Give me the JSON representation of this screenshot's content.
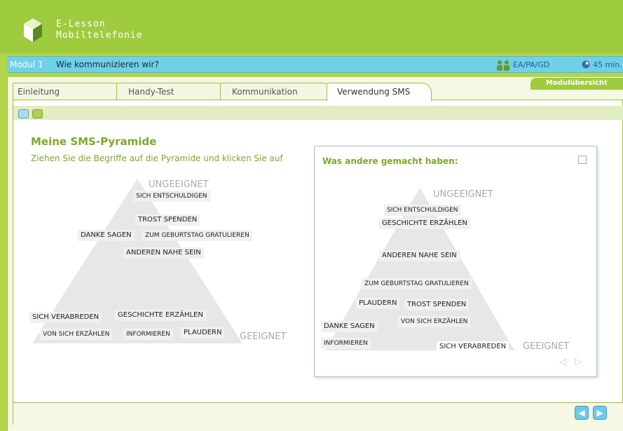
{
  "header": {
    "line1": "E-Lesson",
    "line2": "Mobiltelefonie"
  },
  "module": {
    "number": "Modul 1",
    "title": "Wie kommunizieren wir?",
    "method": "EA/PA/GD",
    "time": "45 min."
  },
  "tabs": [
    {
      "label": "Einleitung"
    },
    {
      "label": "Handy-Test"
    },
    {
      "label": "Kommunikation"
    },
    {
      "label": "Verwendung SMS"
    }
  ],
  "overview_label": "Modulübersicht",
  "main": {
    "heading": "Meine SMS-Pyramide",
    "instruction": "Ziehen Sie die Begriffe auf die Pyramide und klicken Sie auf",
    "top_label": "UNGEEIGNET",
    "bottom_label": "GEEIGNET",
    "chips": [
      "SICH ENTSCHULDIGEN",
      "TROST SPENDEN",
      "DANKE SAGEN",
      "ZUM GEBURTSTAG GRATULIEREN",
      "ANDEREN NAHE SEIN",
      "SICH VERABREDEN",
      "GESCHICHTE ERZÄHLEN",
      "VON SICH ERZÄHLEN",
      "INFORMIEREN",
      "PLAUDERN"
    ]
  },
  "dialog": {
    "title": "Was andere gemacht haben:",
    "top_label": "UNGEEIGNET",
    "bottom_label": "GEEIGNET",
    "chips": [
      "SICH ENTSCHULDIGEN",
      "GESCHICHTE ERZÄHLEN",
      "ANDEREN NAHE SEIN",
      "ZUM GEBURTSTAG GRATULIEREN",
      "PLAUDERN",
      "TROST SPENDEN",
      "VON SICH ERZÄHLEN",
      "DANKE SAGEN",
      "INFORMIEREN",
      "SICH VERABREDEN"
    ]
  },
  "icons": {
    "logo": "e-lesson-logo",
    "people": "people-icon",
    "clock": "clock-icon",
    "prev": "prev-arrow-icon",
    "next": "next-arrow-icon"
  },
  "colors": {
    "brand_green": "#9fcb3f",
    "module_bar": "#6fd0e8",
    "heading_green": "#7da82c",
    "pyramid_grey": "#e7e7e7"
  }
}
